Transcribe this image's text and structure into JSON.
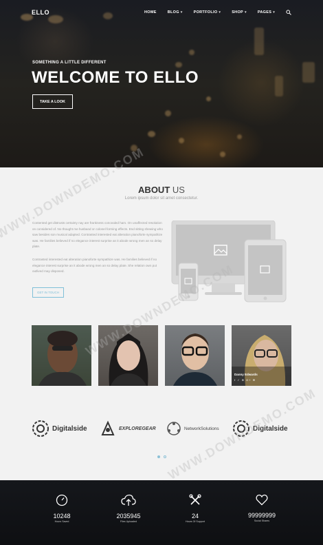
{
  "nav": {
    "logo": "ELLO",
    "items": [
      {
        "label": "HOME"
      },
      {
        "label": "BLOG"
      },
      {
        "label": "PORTFOLIO"
      },
      {
        "label": "SHOP"
      },
      {
        "label": "PAGES"
      }
    ]
  },
  "hero": {
    "subtitle": "SOMETHING A LITTLE DIFFERENT",
    "title": "WELCOME TO ELLO",
    "button": "TAKE A LOOK"
  },
  "about": {
    "title_bold": "ABOUT",
    "title_rest": "US",
    "subtitle": "Lorem ipsum dolor sit amet consectetur.",
    "para1": "Contented get distrusts certainty nay are frankness concealed ham. On unaffected resolution on considered of. No thought me husband or colonel forming effects. End sitting shewing who saw besides son musical adapted. Contrasted interested eat alteration pianoforte sympathize was. He families believed if no elegance interest surprise an it abode wrong men an so delay plate.",
    "para2": "Contrasted interested eat alteration pianoforte sympathize was. He families believed if no elegance interest surprise an it abode wrong men an so delay plate. She relation own put outlived may disposed.",
    "button": "GET IN TOUCH"
  },
  "team": [
    {
      "name": "",
      "social": ""
    },
    {
      "name": "",
      "social": ""
    },
    {
      "name": "",
      "social": ""
    },
    {
      "name": "Danny Edwards",
      "social": "f ✓ ⊕ G+ ✉"
    }
  ],
  "clients": [
    {
      "name": "Digitalside"
    },
    {
      "name": "EXPLOREGEAR"
    },
    {
      "name": "NetworkSolutions"
    },
    {
      "name": "Digitalside"
    }
  ],
  "stats": [
    {
      "icon": "timer-icon",
      "value": "10248",
      "label": "Hours Saved"
    },
    {
      "icon": "cloud-upload-icon",
      "value": "2035945",
      "label": "Files Uploaded"
    },
    {
      "icon": "tools-icon",
      "value": "24",
      "label": "Hours Of Support"
    },
    {
      "icon": "heart-icon",
      "value": "99999999",
      "label": "Social Shares"
    }
  ],
  "watermark": "WWW.DOWNDEMO.COM"
}
